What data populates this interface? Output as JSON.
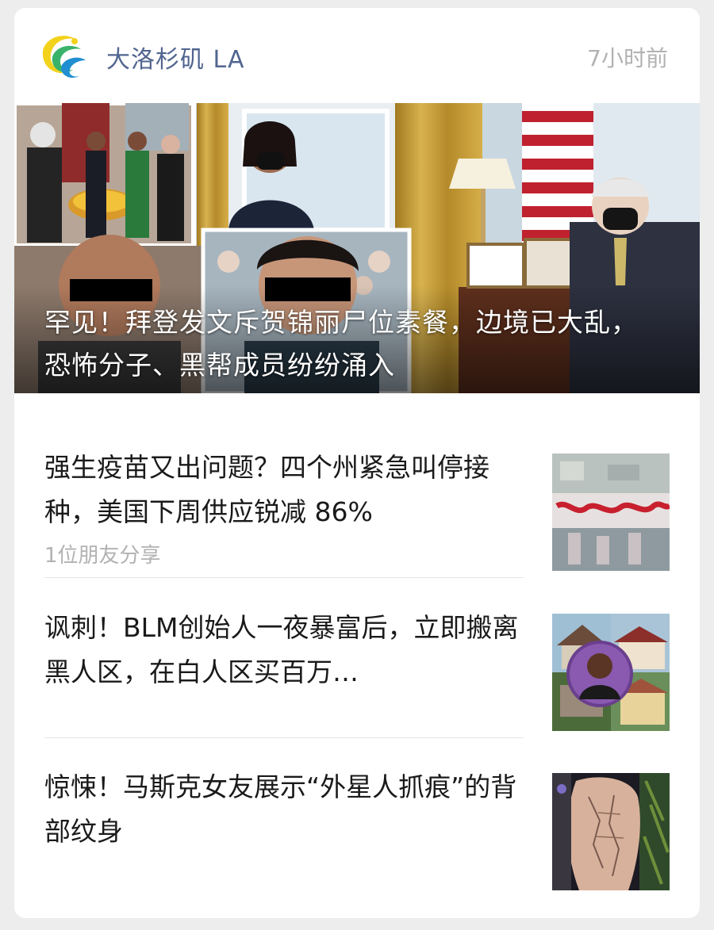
{
  "account": {
    "name": "大洛杉矶 LA",
    "time": "7小时前",
    "logo_icon": "swirl-logo-icon",
    "name_color": "#51658f"
  },
  "hero": {
    "title": "罕见！拜登发文斥贺锦丽尸位素餐，边境已大乱，恐怖分子、黑帮成员纷纷涌入",
    "image": "oval-office-collage-image"
  },
  "articles": [
    {
      "title": "强生疫苗又出问题？四个州紧急叫停接种，美国下周供应锐减 86%",
      "meta": "1位朋友分享",
      "thumb_icon": "vaccine-label-thumbnail"
    },
    {
      "title": "讽刺！BLM创始人一夜暴富后，立即搬离黑人区，在白人区买百万…",
      "meta": "",
      "thumb_icon": "houses-collage-thumbnail"
    },
    {
      "title": "惊悚！马斯克女友展示“外星人抓痕”的背部纹身",
      "meta": "",
      "thumb_icon": "back-tattoo-thumbnail"
    }
  ]
}
